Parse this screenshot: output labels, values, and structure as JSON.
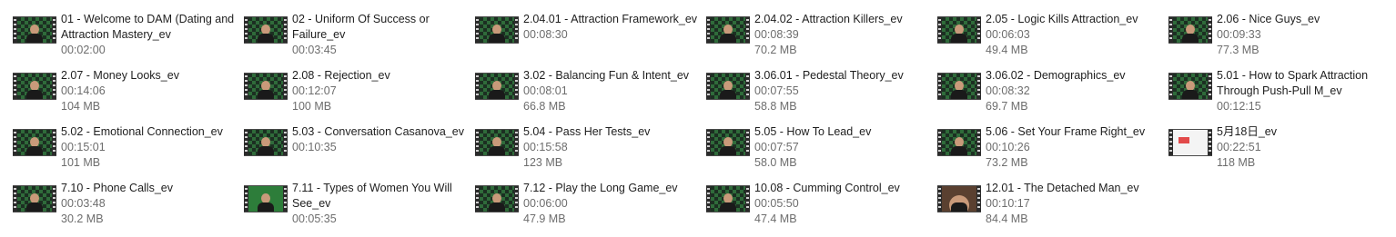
{
  "files": [
    {
      "name": "01 - Welcome to DAM (Dating and Attraction Mastery_ev",
      "duration": "00:02:00",
      "size": "",
      "thumb": "person"
    },
    {
      "name": "02 - Uniform Of Success or Failure_ev",
      "duration": "00:03:45",
      "size": "",
      "thumb": "person"
    },
    {
      "name": "2.04.01 - Attraction Framework_ev",
      "duration": "00:08:30",
      "size": "",
      "thumb": "person"
    },
    {
      "name": "2.04.02 - Attraction Killers_ev",
      "duration": "00:08:39",
      "size": "70.2 MB",
      "thumb": "person"
    },
    {
      "name": "2.05 - Logic Kills Attraction_ev",
      "duration": "00:06:03",
      "size": "49.4 MB",
      "thumb": "person"
    },
    {
      "name": "2.06 - Nice Guys_ev",
      "duration": "00:09:33",
      "size": "77.3 MB",
      "thumb": "person"
    },
    {
      "name": "2.07 - Money Looks_ev",
      "duration": "00:14:06",
      "size": "104 MB",
      "thumb": "person"
    },
    {
      "name": "2.08 - Rejection_ev",
      "duration": "00:12:07",
      "size": "100 MB",
      "thumb": "person"
    },
    {
      "name": "3.02 - Balancing Fun & Intent_ev",
      "duration": "00:08:01",
      "size": "66.8 MB",
      "thumb": "person"
    },
    {
      "name": "3.06.01 - Pedestal Theory_ev",
      "duration": "00:07:55",
      "size": "58.8 MB",
      "thumb": "person"
    },
    {
      "name": "3.06.02 - Demographics_ev",
      "duration": "00:08:32",
      "size": "69.7 MB",
      "thumb": "person"
    },
    {
      "name": "5.01 - How to Spark Attraction Through Push-Pull M_ev",
      "duration": "00:12:15",
      "size": "",
      "thumb": "person"
    },
    {
      "name": "5.02 - Emotional Connection_ev",
      "duration": "00:15:01",
      "size": "101 MB",
      "thumb": "person"
    },
    {
      "name": "5.03 - Conversation Casanova_ev",
      "duration": "00:10:35",
      "size": "",
      "thumb": "person"
    },
    {
      "name": "5.04 - Pass Her Tests_ev",
      "duration": "00:15:58",
      "size": "123 MB",
      "thumb": "person"
    },
    {
      "name": "5.05 - How To Lead_ev",
      "duration": "00:07:57",
      "size": "58.0 MB",
      "thumb": "person"
    },
    {
      "name": "5.06 - Set Your Frame Right_ev",
      "duration": "00:10:26",
      "size": "73.2 MB",
      "thumb": "person"
    },
    {
      "name": "5月18日_ev",
      "duration": "00:22:51",
      "size": "118 MB",
      "thumb": "slide"
    },
    {
      "name": "7.10 - Phone Calls_ev",
      "duration": "00:03:48",
      "size": "30.2 MB",
      "thumb": "person"
    },
    {
      "name": "7.11 - Types of Women You Will See_ev",
      "duration": "00:05:35",
      "size": "",
      "thumb": "green"
    },
    {
      "name": "7.12 - Play the Long Game_ev",
      "duration": "00:06:00",
      "size": "47.9 MB",
      "thumb": "person"
    },
    {
      "name": "10.08 - Cumming Control_ev",
      "duration": "00:05:50",
      "size": "47.4 MB",
      "thumb": "person"
    },
    {
      "name": "12.01 - The Detached Man_ev",
      "duration": "00:10:17",
      "size": "84.4 MB",
      "thumb": "closeup"
    }
  ],
  "icons": {
    "video": "video-file-icon"
  }
}
